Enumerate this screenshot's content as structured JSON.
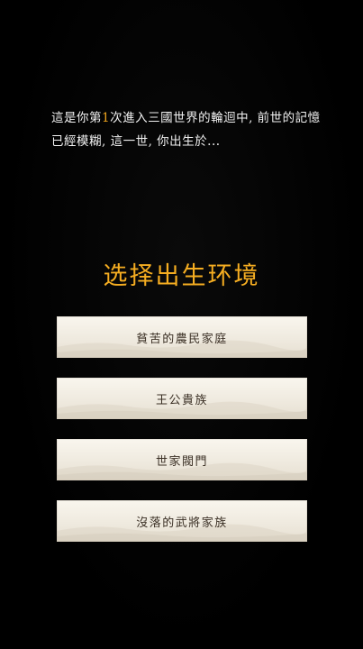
{
  "intro": {
    "prefix": "這是你第",
    "count": "1",
    "suffix": "次進入三國世界的輪迴中, 前世的記憶已經模糊, 這一世, 你出生於..."
  },
  "title": "选择出生环境",
  "options": [
    {
      "label": "貧苦的農民家庭"
    },
    {
      "label": "王公貴族"
    },
    {
      "label": "世家閥門"
    },
    {
      "label": "沒落的武將家族"
    }
  ],
  "colors": {
    "background": "#000000",
    "accent": "#f5ad21",
    "option_bg": "#f3efe5",
    "option_text": "#3a2f24",
    "intro_text": "#f2f2f2"
  }
}
